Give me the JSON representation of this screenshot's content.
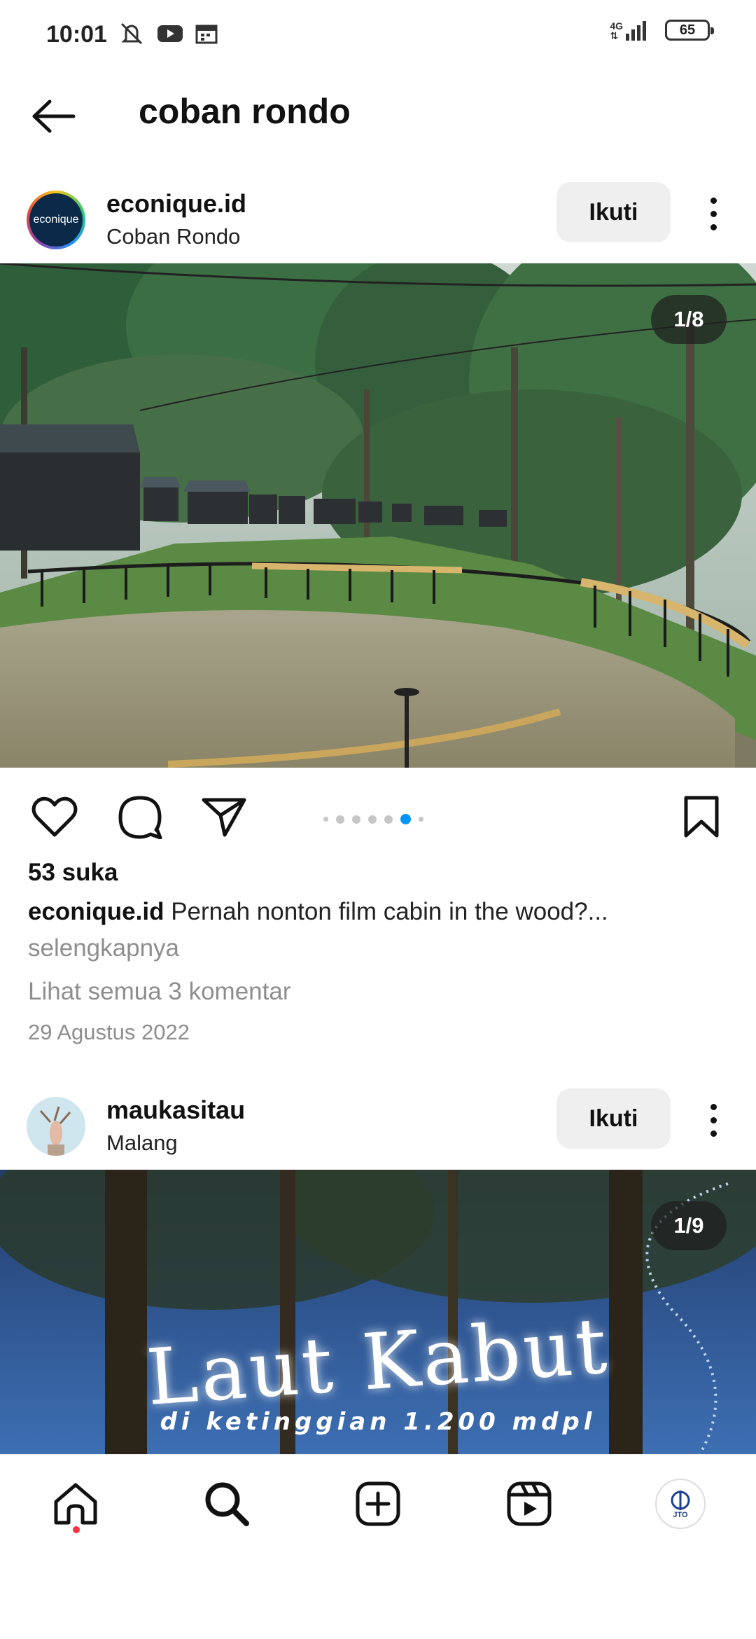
{
  "status_bar": {
    "time": "10:01",
    "network": "4G",
    "battery": "65",
    "icons": [
      "mute-icon",
      "youtube-icon",
      "calendar-icon",
      "signal-icon",
      "battery-icon"
    ]
  },
  "header": {
    "title": "coban rondo",
    "back_icon": "arrow-left-icon"
  },
  "posts": [
    {
      "username": "econique.id",
      "avatar_text": "econique",
      "location": "Coban Rondo",
      "follow_label": "Ikuti",
      "image_counter": "1/8",
      "likes": "53 suka",
      "caption_user": "econique.id",
      "caption_text": "Pernah nonton film cabin in the wood?...",
      "more_label": "selengkapnya",
      "comments_label": "Lihat semua 3 komentar",
      "date": "29 Agustus 2022",
      "carousel_active_index": 5,
      "carousel_dot_count": 7
    },
    {
      "username": "maukasitau",
      "location": "Malang",
      "follow_label": "Ikuti",
      "image_counter": "1/9",
      "image_title": "Laut Kabut",
      "image_subtitle": "di ketinggian 1.200 mdpl"
    }
  ],
  "actions": {
    "icons": [
      "heart-icon",
      "comment-icon",
      "share-icon",
      "bookmark-icon"
    ]
  },
  "bottom_nav": {
    "items": [
      "home-icon",
      "search-icon",
      "create-icon",
      "reels-icon",
      "profile-avatar"
    ],
    "profile_text": "JTO"
  },
  "colors": {
    "accent": "#0095f6",
    "notification": "#ff3040",
    "follow_button_bg": "#efefef",
    "muted_text": "#8e8e8e"
  }
}
